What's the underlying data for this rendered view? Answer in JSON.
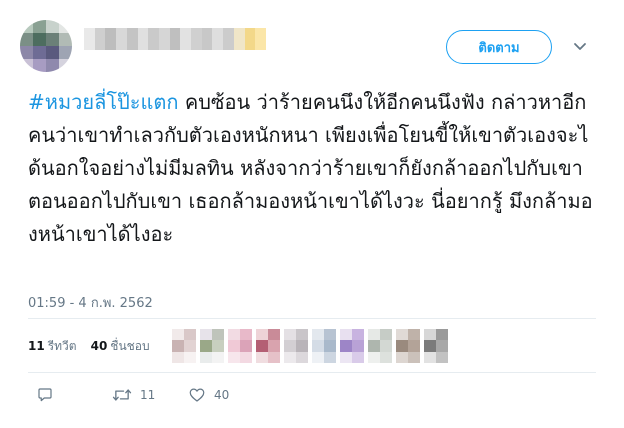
{
  "header": {
    "follow_label": "ติดตาม"
  },
  "tweet": {
    "hashtag": "#หมวยลี่โป๊ะแตก",
    "body": " คบซ้อน ว่าร้ายคนนึงให้อีกคนนึงฟัง กล่าวหาอีกคนว่าเขาทำเลวกับตัวเองหนักหนา เพียงเพื่อโยนขี้ให้เขาตัวเองจะได้นอกใจอย่างไม่มีมลทิน หลังจากว่าร้ายเขาก็ยังกล้าออกไปกับเขา ตอนออกไปกับเขา เธอกล้ามองหน้าเขาได้ไงวะ นี่อยากรู้ มึงกล้ามองหน้าเขาได้ไงอะ",
    "timestamp": "01:59 - 4 ก.พ. 2562"
  },
  "stats": {
    "retweet_count": "11",
    "retweet_label": "รีทวีต",
    "like_count": "40",
    "like_label": "ชื่นชอบ"
  },
  "actions": {
    "reply_count": "",
    "retweet_count": "11",
    "like_count": "40"
  },
  "colors": {
    "accent": "#1da1f2",
    "hashtag": "#1b95e0",
    "muted": "#657786"
  },
  "icons": {
    "reply": "reply-icon",
    "retweet": "retweet-icon",
    "like": "heart-icon",
    "more": "chevron-down-icon"
  }
}
